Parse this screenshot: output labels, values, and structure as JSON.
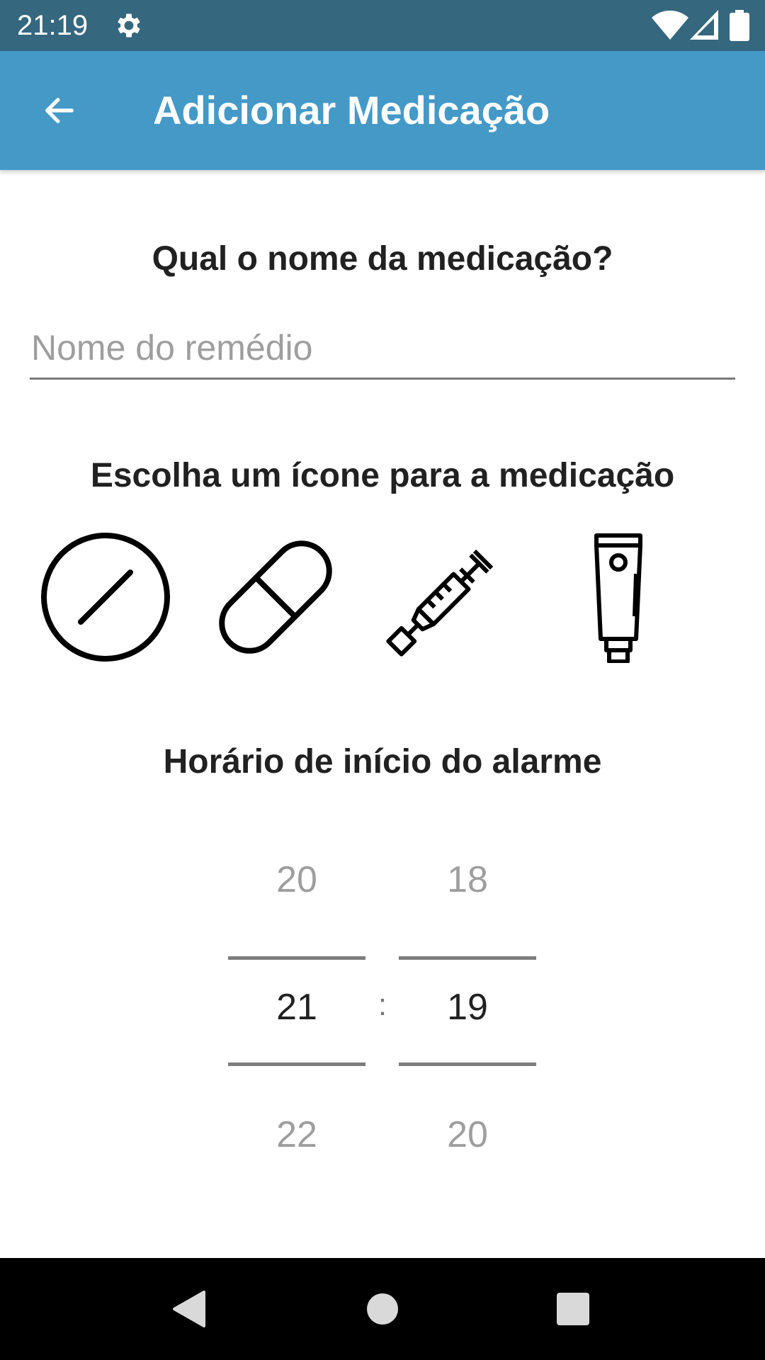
{
  "status_bar": {
    "time": "21:19",
    "icons": [
      "gear-icon",
      "wifi-icon",
      "signal-icon",
      "battery-icon"
    ]
  },
  "app_bar": {
    "back_icon": "arrow-left-icon",
    "title": "Adicionar Medicação",
    "background": "#4499c7"
  },
  "name_section": {
    "title": "Qual o nome da medicação?",
    "input_value": "",
    "input_placeholder": "Nome do remédio"
  },
  "icon_section": {
    "title": "Escolha um ícone para a medicação",
    "icons": [
      "pill-round-icon",
      "capsule-icon",
      "syringe-icon",
      "ointment-tube-icon"
    ]
  },
  "alarm_section": {
    "title": "Horário de início do alarme",
    "separator": ":",
    "hours": {
      "prev": "20",
      "selected": "21",
      "next": "22"
    },
    "minutes": {
      "prev": "18",
      "selected": "19",
      "next": "20"
    }
  },
  "nav_bar": {
    "icons": [
      "back-triangle-icon",
      "home-circle-icon",
      "recents-square-icon"
    ]
  }
}
